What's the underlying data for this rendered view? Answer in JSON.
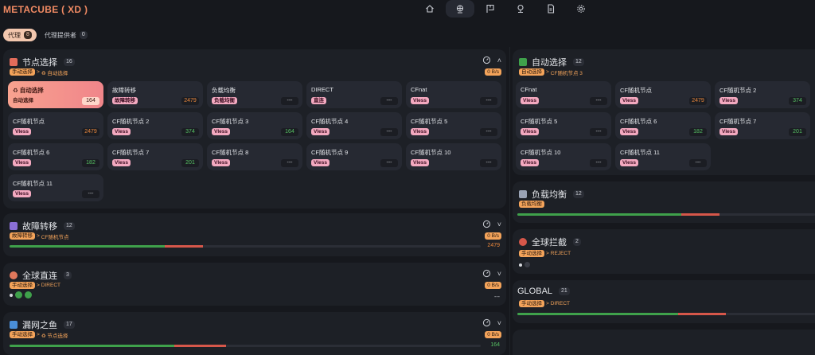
{
  "brand": "METACUBE ( XD )",
  "nav": [
    {
      "icon": "home-icon"
    },
    {
      "icon": "globe-icon"
    },
    {
      "icon": "flag-icon"
    },
    {
      "icon": "location-icon"
    },
    {
      "icon": "file-icon"
    },
    {
      "icon": "gear-icon"
    }
  ],
  "subtabs": [
    {
      "label": "代理",
      "count": "8"
    },
    {
      "label": "代理提供者",
      "count": "0"
    }
  ],
  "colors": {
    "accent": "#f08a63",
    "good": "#3fa14b",
    "bad": "#d6574a",
    "tag": "#f3a9c0",
    "warn": "#f3a35a"
  },
  "groups": {
    "node_select": {
      "title": "节点选择",
      "count": "16",
      "crumb_a": "手动选择",
      "crumb_b": "♻ 自动选择",
      "speed": "0 B/s",
      "proxies": [
        {
          "name": "♻ 自动选择",
          "tag": "自动选择",
          "latency": "164",
          "lc": "#3a1510"
        },
        {
          "name": "故障转移",
          "tag": "故障转移",
          "latency": "2479",
          "lc": "#e8863c"
        },
        {
          "name": "负载均衡",
          "tag": "负载均衡",
          "latency": "---",
          "lc": "#c9ccd3"
        },
        {
          "name": "DIRECT",
          "tag": "直连",
          "latency": "---",
          "lc": "#c9ccd3"
        },
        {
          "name": "CFnat",
          "tag": "Vless",
          "latency": "---",
          "lc": "#c9ccd3"
        },
        {
          "name": "CF随机节点",
          "tag": "Vless",
          "latency": "2479",
          "lc": "#e8863c"
        },
        {
          "name": "CF随机节点 2",
          "tag": "Vless",
          "latency": "374",
          "lc": "#56c063"
        },
        {
          "name": "CF随机节点 3",
          "tag": "Vless",
          "latency": "164",
          "lc": "#56c063"
        },
        {
          "name": "CF随机节点 4",
          "tag": "Vless",
          "latency": "---",
          "lc": "#c9ccd3"
        },
        {
          "name": "CF随机节点 5",
          "tag": "Vless",
          "latency": "---",
          "lc": "#c9ccd3"
        },
        {
          "name": "CF随机节点 6",
          "tag": "Vless",
          "latency": "182",
          "lc": "#56c063"
        },
        {
          "name": "CF随机节点 7",
          "tag": "Vless",
          "latency": "201",
          "lc": "#56c063"
        },
        {
          "name": "CF随机节点 8",
          "tag": "Vless",
          "latency": "---",
          "lc": "#c9ccd3"
        },
        {
          "name": "CF随机节点 9",
          "tag": "Vless",
          "latency": "---",
          "lc": "#c9ccd3"
        },
        {
          "name": "CF随机节点 10",
          "tag": "Vless",
          "latency": "---",
          "lc": "#c9ccd3"
        },
        {
          "name": "CF随机节点 11",
          "tag": "Vless",
          "latency": "---",
          "lc": "#c9ccd3"
        }
      ]
    },
    "failover": {
      "title": "故障转移",
      "count": "12",
      "crumb_a": "故障转移",
      "crumb_b": "CF随机节点",
      "speed": "0 B/s",
      "latency": "2479",
      "green": 0.33,
      "red": 0.08
    },
    "direct": {
      "title": "全球直连",
      "count": "3",
      "crumb_a": "手动选择",
      "crumb_b": "DIRECT",
      "speed": "0 B/s",
      "latency": "---"
    },
    "leak": {
      "title": "漏网之鱼",
      "count": "17",
      "crumb_a": "手动选择",
      "crumb_b": "♻ 节点选择",
      "speed": "0 B/s",
      "latency": "164",
      "green": 0.35,
      "red": 0.11
    },
    "auto": {
      "title": "自动选择",
      "count": "12",
      "crumb_a": "自动选择",
      "crumb_b": "CF随机节点 3",
      "proxies": [
        {
          "name": "CFnat",
          "tag": "Vless",
          "latency": "---",
          "lc": "#c9ccd3"
        },
        {
          "name": "CF随机节点",
          "tag": "Vless",
          "latency": "2479",
          "lc": "#e8863c"
        },
        {
          "name": "CF随机节点 2",
          "tag": "Vless",
          "latency": "374",
          "lc": "#56c063"
        },
        {
          "name": "CF随机节点 5",
          "tag": "Vless",
          "latency": "---",
          "lc": "#c9ccd3"
        },
        {
          "name": "CF随机节点 6",
          "tag": "Vless",
          "latency": "182",
          "lc": "#56c063"
        },
        {
          "name": "CF随机节点 7",
          "tag": "Vless",
          "latency": "201",
          "lc": "#56c063"
        },
        {
          "name": "CF随机节点 10",
          "tag": "Vless",
          "latency": "---",
          "lc": "#c9ccd3"
        },
        {
          "name": "CF随机节点 11",
          "tag": "Vless",
          "latency": "---",
          "lc": "#c9ccd3"
        }
      ]
    },
    "balance": {
      "title": "负载均衡",
      "count": "12",
      "crumb_a": "负载均衡",
      "green": 0.55,
      "red": 0.13
    },
    "reject": {
      "title": "全球拦截",
      "count": "2",
      "crumb_a": "手动选择",
      "crumb_b": "REJECT"
    },
    "global": {
      "title": "GLOBAL",
      "count": "21",
      "crumb_a": "手动选择",
      "crumb_b": "DIRECT",
      "green": 0.54,
      "red": 0.16
    }
  }
}
